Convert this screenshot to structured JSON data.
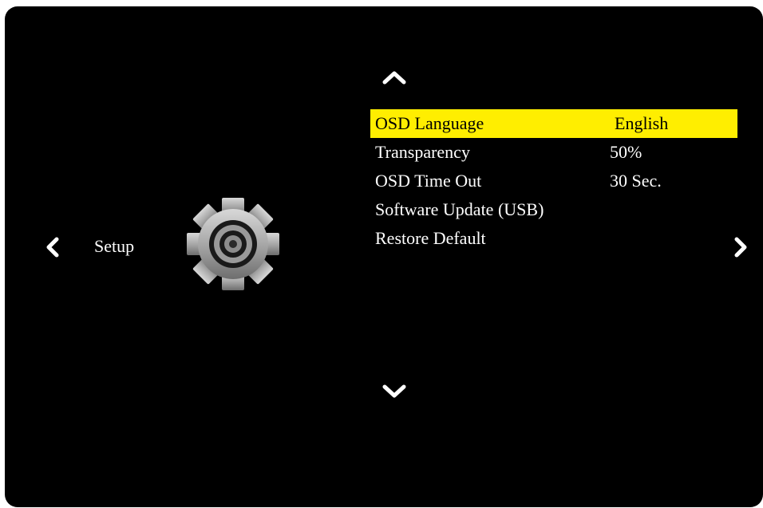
{
  "section": {
    "label": "Setup",
    "icon": "gear-icon"
  },
  "nav": {
    "left_icon": "chevron-left-icon",
    "right_icon": "chevron-right-icon",
    "up_icon": "chevron-up-icon",
    "down_icon": "chevron-down-icon"
  },
  "menu": {
    "items": [
      {
        "label": "OSD Language",
        "value": "English",
        "selected": true
      },
      {
        "label": "Transparency",
        "value": "50%",
        "selected": false
      },
      {
        "label": "OSD Time Out",
        "value": "30 Sec.",
        "selected": false
      },
      {
        "label": "Software Update (USB)",
        "value": "",
        "selected": false
      },
      {
        "label": "Restore Default",
        "value": "",
        "selected": false
      }
    ]
  },
  "colors": {
    "background": "#000000",
    "highlight": "#ffee00",
    "text": "#ffffff",
    "selected_text": "#000000"
  }
}
